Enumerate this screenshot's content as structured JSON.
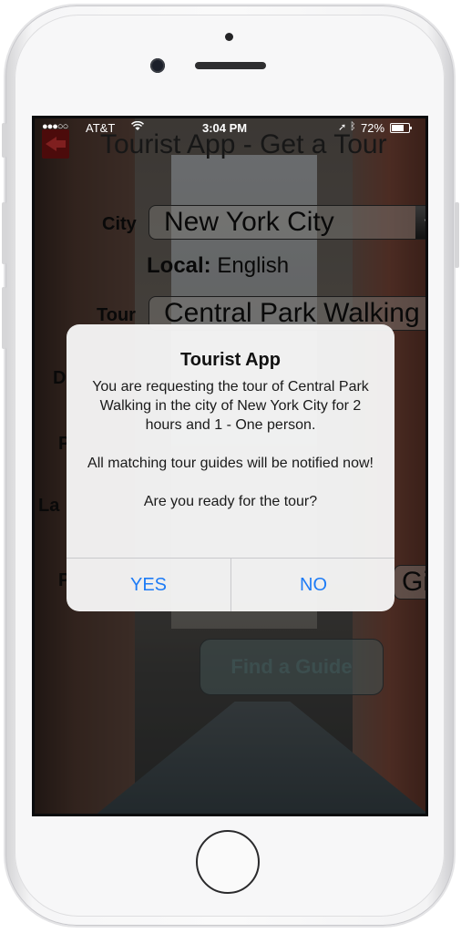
{
  "status_bar": {
    "signal": "●●●○○",
    "carrier": "AT&T",
    "wifi_icon": "wifi-icon",
    "time": "3:04 PM",
    "location_icon": "location-arrow-icon",
    "bluetooth_icon": "bluetooth-icon",
    "battery": "72%"
  },
  "header": {
    "title": "Tourist App - Get a Tour",
    "back_icon": "back-arrow-icon"
  },
  "form": {
    "city_label": "City",
    "city_value": "New York City",
    "local_label": "Local:",
    "local_value": "English",
    "tour_label": "Tour",
    "tour_value": "Central Park Walking",
    "partial_labels": [
      "D",
      "P",
      "La",
      "P"
    ],
    "gift_value": "Gif",
    "find_guide_label": "Find a Guide"
  },
  "alert": {
    "title": "Tourist App",
    "message": "You are requesting the tour of Central Park Walking in the city of New York City for 2 hours and 1 - One person.\n\nAll matching tour guides will be notified now!\n\nAre you ready for the tour?",
    "yes_label": "YES",
    "no_label": "NO"
  },
  "colors": {
    "alert_button": "#1e7cf6",
    "back_icon": "#e83a3a"
  }
}
